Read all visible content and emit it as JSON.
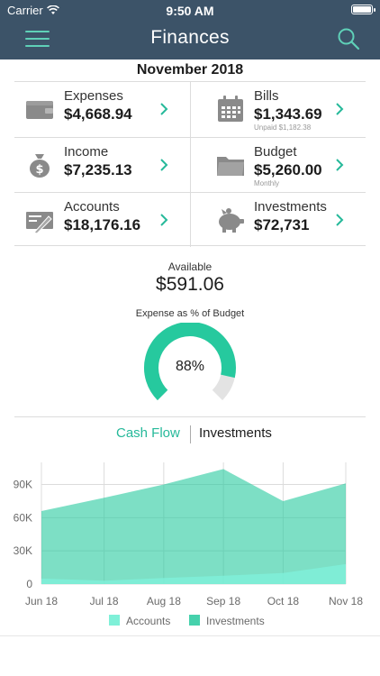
{
  "status": {
    "carrier": "Carrier",
    "time": "9:50 AM"
  },
  "nav": {
    "title": "Finances",
    "menu_icon": "hamburger-icon",
    "search_icon": "search-icon"
  },
  "month": "November 2018",
  "summary": [
    {
      "label": "Expenses",
      "value": "$4,668.94",
      "sub": "",
      "icon": "wallet-icon"
    },
    {
      "label": "Bills",
      "value": "$1,343.69",
      "sub": "Unpaid $1,182.38",
      "icon": "calendar-icon"
    },
    {
      "label": "Income",
      "value": "$7,235.13",
      "sub": "",
      "icon": "money-bag-icon"
    },
    {
      "label": "Budget",
      "value": "$5,260.00",
      "sub": "Monthly",
      "icon": "folder-icon"
    },
    {
      "label": "Accounts",
      "value": "$18,176.16",
      "sub": "",
      "icon": "cheque-icon"
    },
    {
      "label": "Investments",
      "value": "$72,731",
      "sub": "",
      "icon": "piggy-bank-icon"
    }
  ],
  "available": {
    "label": "Available",
    "value": "$591.06"
  },
  "expense_gauge": {
    "label": "Expense as % of Budget",
    "text": "88%",
    "fraction": 0.88
  },
  "tabs": {
    "active": "Cash Flow",
    "inactive": "Investments"
  },
  "colors": {
    "header": "#3c5368",
    "accent": "#26b99a",
    "accounts": "#7ff0d8",
    "investments": "#26c99e",
    "gauge_track": "#e3e3e3"
  },
  "chart_data": {
    "type": "area",
    "categories": [
      "Jun 18",
      "Jul 18",
      "Aug 18",
      "Sep 18",
      "Oct 18",
      "Nov 18"
    ],
    "y_ticks": [
      "0",
      "30K",
      "60K",
      "90K"
    ],
    "ylim": [
      0,
      110000
    ],
    "x_range": [
      -0.05,
      5.05
    ],
    "series": [
      {
        "name": "Accounts",
        "x": [
          -0.05,
          1,
          2,
          3,
          4,
          5.05
        ],
        "values": [
          5000,
          3000,
          5500,
          7500,
          10000,
          18000
        ]
      },
      {
        "name": "Investments",
        "x": [
          -0.05,
          1,
          2,
          3,
          4,
          5.05
        ],
        "values": [
          66000,
          78000,
          90000,
          104000,
          75000,
          91000
        ]
      }
    ],
    "grid": true,
    "legend": "bottom"
  }
}
